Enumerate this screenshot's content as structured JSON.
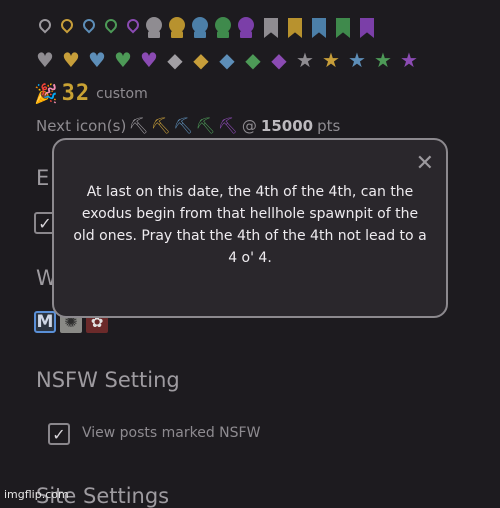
{
  "icons": {
    "row1": [
      {
        "kind": "pin",
        "name": "pin-gray-icon",
        "color": "#9b989d"
      },
      {
        "kind": "pin",
        "name": "pin-gold-icon",
        "color": "#c79e3a"
      },
      {
        "kind": "pin",
        "name": "pin-blue-icon",
        "color": "#5d8eb8"
      },
      {
        "kind": "pin",
        "name": "pin-green-icon",
        "color": "#4d9a57"
      },
      {
        "kind": "pin",
        "name": "pin-purple-icon",
        "color": "#8b4bb3"
      },
      {
        "kind": "medal",
        "name": "medal-gray-icon",
        "color": "#8f8c91"
      },
      {
        "kind": "medal",
        "name": "medal-gold-icon",
        "color": "#b8922e"
      },
      {
        "kind": "medal",
        "name": "medal-blue-icon",
        "color": "#4c7fa8"
      },
      {
        "kind": "medal",
        "name": "medal-green-icon",
        "color": "#3f8a4c"
      },
      {
        "kind": "medal",
        "name": "medal-purple-icon",
        "color": "#7b3fa8"
      },
      {
        "kind": "bookmark",
        "name": "bookmark-gray-icon",
        "color": "#8f8c91"
      },
      {
        "kind": "bookmark",
        "name": "bookmark-gold-icon",
        "color": "#b8922e"
      },
      {
        "kind": "bookmark",
        "name": "bookmark-blue-icon",
        "color": "#4c7fa8"
      },
      {
        "kind": "bookmark",
        "name": "bookmark-green-icon",
        "color": "#3f8a4c"
      },
      {
        "kind": "bookmark",
        "name": "bookmark-purple-icon",
        "color": "#7b3fa8"
      }
    ],
    "row2": [
      {
        "kind": "heart",
        "name": "heart-gray-icon",
        "color": "#8f8c91",
        "glyph": "♥"
      },
      {
        "kind": "heart",
        "name": "heart-gold-icon",
        "color": "#c79e3a",
        "glyph": "♥"
      },
      {
        "kind": "heart",
        "name": "heart-blue-icon",
        "color": "#5d8eb8",
        "glyph": "♥"
      },
      {
        "kind": "heart",
        "name": "heart-green-icon",
        "color": "#4d9a57",
        "glyph": "♥"
      },
      {
        "kind": "heart",
        "name": "heart-purple-icon",
        "color": "#8b4bb3",
        "glyph": "♥"
      },
      {
        "kind": "gem",
        "name": "gem-gray-icon",
        "color": "#a19ea3",
        "glyph": "◆"
      },
      {
        "kind": "gem",
        "name": "gem-gold-icon",
        "color": "#c79e3a",
        "glyph": "◆"
      },
      {
        "kind": "gem",
        "name": "gem-blue-icon",
        "color": "#5d8eb8",
        "glyph": "◆"
      },
      {
        "kind": "gem",
        "name": "gem-green-icon",
        "color": "#4d9a57",
        "glyph": "◆"
      },
      {
        "kind": "gem",
        "name": "gem-purple-icon",
        "color": "#8b4bb3",
        "glyph": "◆"
      },
      {
        "kind": "star",
        "name": "star-gray-icon",
        "color": "#8f8c91",
        "glyph": "★"
      },
      {
        "kind": "star",
        "name": "star-gold-icon",
        "color": "#c79e3a",
        "glyph": "★"
      },
      {
        "kind": "star",
        "name": "star-blue-icon",
        "color": "#5d8eb8",
        "glyph": "★"
      },
      {
        "kind": "star",
        "name": "star-green-icon",
        "color": "#4d9a57",
        "glyph": "★"
      },
      {
        "kind": "star",
        "name": "star-purple-icon",
        "color": "#8b4bb3",
        "glyph": "★"
      }
    ]
  },
  "custom_badge": {
    "icon": "party-popper-icon",
    "number": "32",
    "label": "custom"
  },
  "next_icon": {
    "label": "Next icon(s)",
    "pickaxes": [
      {
        "name": "pickaxe-gray-icon",
        "color": "#a19ea3"
      },
      {
        "name": "pickaxe-gold-icon",
        "color": "#c79e3a"
      },
      {
        "name": "pickaxe-blue-icon",
        "color": "#5d8eb8"
      },
      {
        "name": "pickaxe-green-icon",
        "color": "#4d9a57"
      },
      {
        "name": "pickaxe-purple-icon",
        "color": "#8b4bb3"
      }
    ],
    "at": "@",
    "points": "15000",
    "unit": "pts"
  },
  "widget_icons": [
    {
      "name": "widget-m-icon",
      "text": "M"
    },
    {
      "name": "widget-gear-icon",
      "text": ""
    },
    {
      "name": "widget-flower-icon",
      "text": ""
    }
  ],
  "nsfw": {
    "heading": "NSFW Setting",
    "checkbox_label": "View posts marked NSFW",
    "checked": true
  },
  "site": {
    "heading": "Site Settings"
  },
  "modal": {
    "text": "At last on this date, the 4th of the 4th, can the exodus begin from that hellhole spawnpit of the old ones. Pray that the 4th of the 4th not lead to a 4 o' 4.",
    "close": "✕"
  },
  "watermark": "imgflip.com"
}
